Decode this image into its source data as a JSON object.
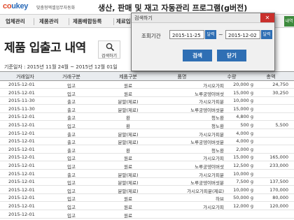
{
  "header": {
    "logo_co": "co",
    "logo_ukey": "ukey",
    "logo_sub": "맞춤형엑셀업무자동화",
    "title": "생산, 판매 및 재고 자동관리 프로그램(g버전)"
  },
  "menu": {
    "items": [
      "업체관리",
      "제품관리",
      "제품배합등록",
      "제료입"
    ],
    "right_tab": "내역"
  },
  "page": {
    "title": "제품 입출고 내역",
    "search_label": "검색하기",
    "period": "기준일자 : 2015년 11월 24월 ~ 2015년 12월 01일"
  },
  "table": {
    "headers": [
      "거래일자",
      "거래구분",
      "제품구분",
      "품명",
      "수량",
      "총액"
    ],
    "rows": [
      [
        "2015-12-01",
        "입고",
        "원료",
        "가시오가피",
        "20,000 g",
        "24,750"
      ],
      [
        "2015-12-01",
        "입고",
        "원료",
        "노루궁뎅이버섯",
        "15,000 g",
        "30,250"
      ],
      [
        "2015-11-30",
        "출고",
        "분말(제료)",
        "가시오가피분",
        "10,000 g",
        ""
      ],
      [
        "2015-11-30",
        "출고",
        "분말(제료)",
        "노루궁뎅이버섯분",
        "15,000 g",
        ""
      ],
      [
        "2015-12-01",
        "출고",
        "환",
        "청노환",
        "4,800 g",
        ""
      ],
      [
        "2015-12-01",
        "입고",
        "환",
        "청노환",
        "500 g",
        "5,500"
      ],
      [
        "2015-12-01",
        "출고",
        "분말(제료)",
        "가시오가피분",
        "4,000 g",
        ""
      ],
      [
        "2015-12-01",
        "출고",
        "분말(제료)",
        "노루궁뎅이버섯분",
        "4,000 g",
        ""
      ],
      [
        "2015-12-01",
        "출고",
        "환",
        "청노환",
        "2,000 g",
        ""
      ],
      [
        "2015-12-01",
        "입고",
        "원료",
        "가시오가피",
        "15,000 g",
        "165,000"
      ],
      [
        "2015-12-01",
        "입고",
        "원료",
        "노루궁뎅이버섯",
        "12,500 g",
        "233,000"
      ],
      [
        "2015-12-01",
        "출고",
        "분말(제료)",
        "가시오가피분",
        "10,000 g",
        ""
      ],
      [
        "2015-12-01",
        "입고",
        "분말(제료)",
        "노루궁뎅이버섯분",
        "7,500 g",
        "137,500"
      ],
      [
        "2015-12-01",
        "입고",
        "분말(제료)",
        "가시오가피분(제료)",
        "10,000 g",
        "170,000"
      ],
      [
        "2015-12-01",
        "입고",
        "원료",
        "하브",
        "50,000 g",
        "80,000"
      ],
      [
        "2015-12-01",
        "입고",
        "원료",
        "가시오가피",
        "12,000 g",
        "120,000"
      ],
      [
        "2015-12-01",
        "입고",
        "원료",
        "",
        "",
        ""
      ]
    ]
  },
  "dialog": {
    "title": "검색하기",
    "close": "✕",
    "label": "조회기간",
    "start_date": "2015-11-25",
    "end_date": "2015-12-02",
    "cal_label": "달력",
    "tilde": "~",
    "search_button": "검색",
    "close_button": "닫기"
  },
  "colors": {
    "accent": "#2f6fb4",
    "close_red": "#c9302c",
    "logo_orange": "#e04a2a",
    "logo_blue": "#2a6ab8"
  }
}
